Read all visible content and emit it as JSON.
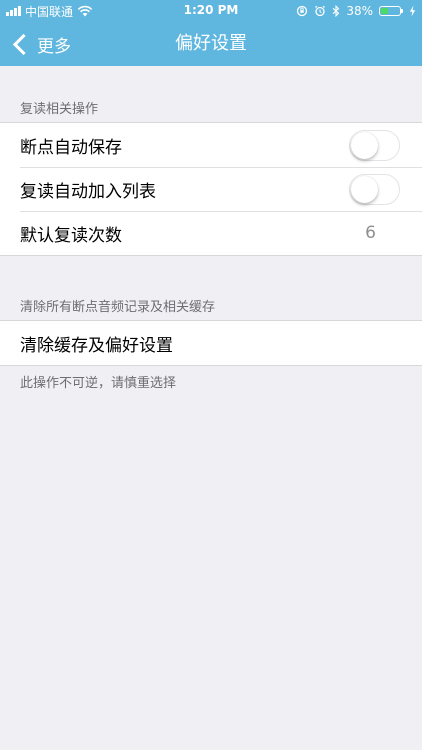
{
  "status_bar": {
    "carrier": "中国联通",
    "time": "1:20 PM",
    "battery_percent": "38%",
    "battery_level": 0.38,
    "battery_color": "#4cd964",
    "icons": [
      "signal-icon",
      "wifi-icon",
      "orientation-lock-icon",
      "alarm-icon",
      "bluetooth-icon",
      "battery-icon",
      "charging-icon"
    ]
  },
  "nav": {
    "back_label": "更多",
    "title": "偏好设置",
    "bar_color": "#5fb6de"
  },
  "section1": {
    "header": "复读相关操作",
    "rows": [
      {
        "label": "断点自动保存",
        "toggle_on": false
      },
      {
        "label": "复读自动加入列表",
        "toggle_on": false
      },
      {
        "label": "默认复读次数",
        "value": "6"
      }
    ]
  },
  "section2": {
    "header": "清除所有断点音频记录及相关缓存",
    "rows": [
      {
        "label": "清除缓存及偏好设置"
      }
    ],
    "footer": "此操作不可逆，请慎重选择"
  }
}
